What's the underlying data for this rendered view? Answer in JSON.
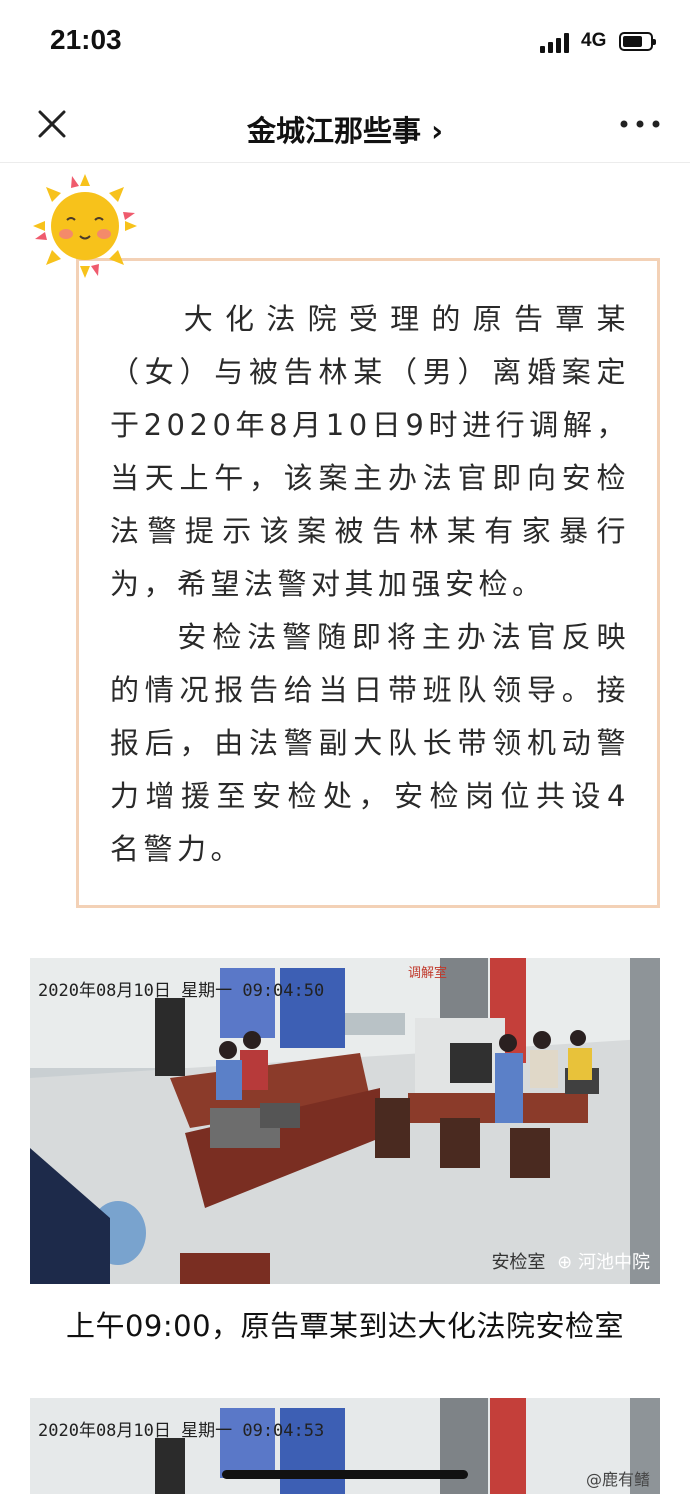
{
  "status_bar": {
    "time": "21:03",
    "network": "4G"
  },
  "nav": {
    "title": "金城江那些事 ›",
    "close_icon": "close-icon",
    "more_icon": "more-icon"
  },
  "article": {
    "para1": "大化法院受理的原告覃某（女）与被告林某（男）离婚案定于2020年8月10日9时进行调解，当天上午，该案主办法官即向安检法警提示该案被告林某有家暴行为，希望法警对其加强安检。",
    "para2": "安检法警随即将主办法官反映的情况报告给当日带班队领导。接报后，由法警副大队长带领机动警力增援至安检处，安检岗位共设4名警力。"
  },
  "photo1": {
    "timestamp": "2020年08月10日 星期一 09:04:50",
    "room_label": "安检室",
    "watermark": "河池中院",
    "door_sign": "调解室"
  },
  "photo1_caption": "上午09:00，原告覃某到达大化法院安检室",
  "photo2": {
    "timestamp": "2020年08月10日 星期一 09:04:53"
  },
  "weibo_mark": "@鹿有鳍",
  "colors": {
    "frame_border": "#f3d1b6",
    "sun": "#f7c21b"
  }
}
